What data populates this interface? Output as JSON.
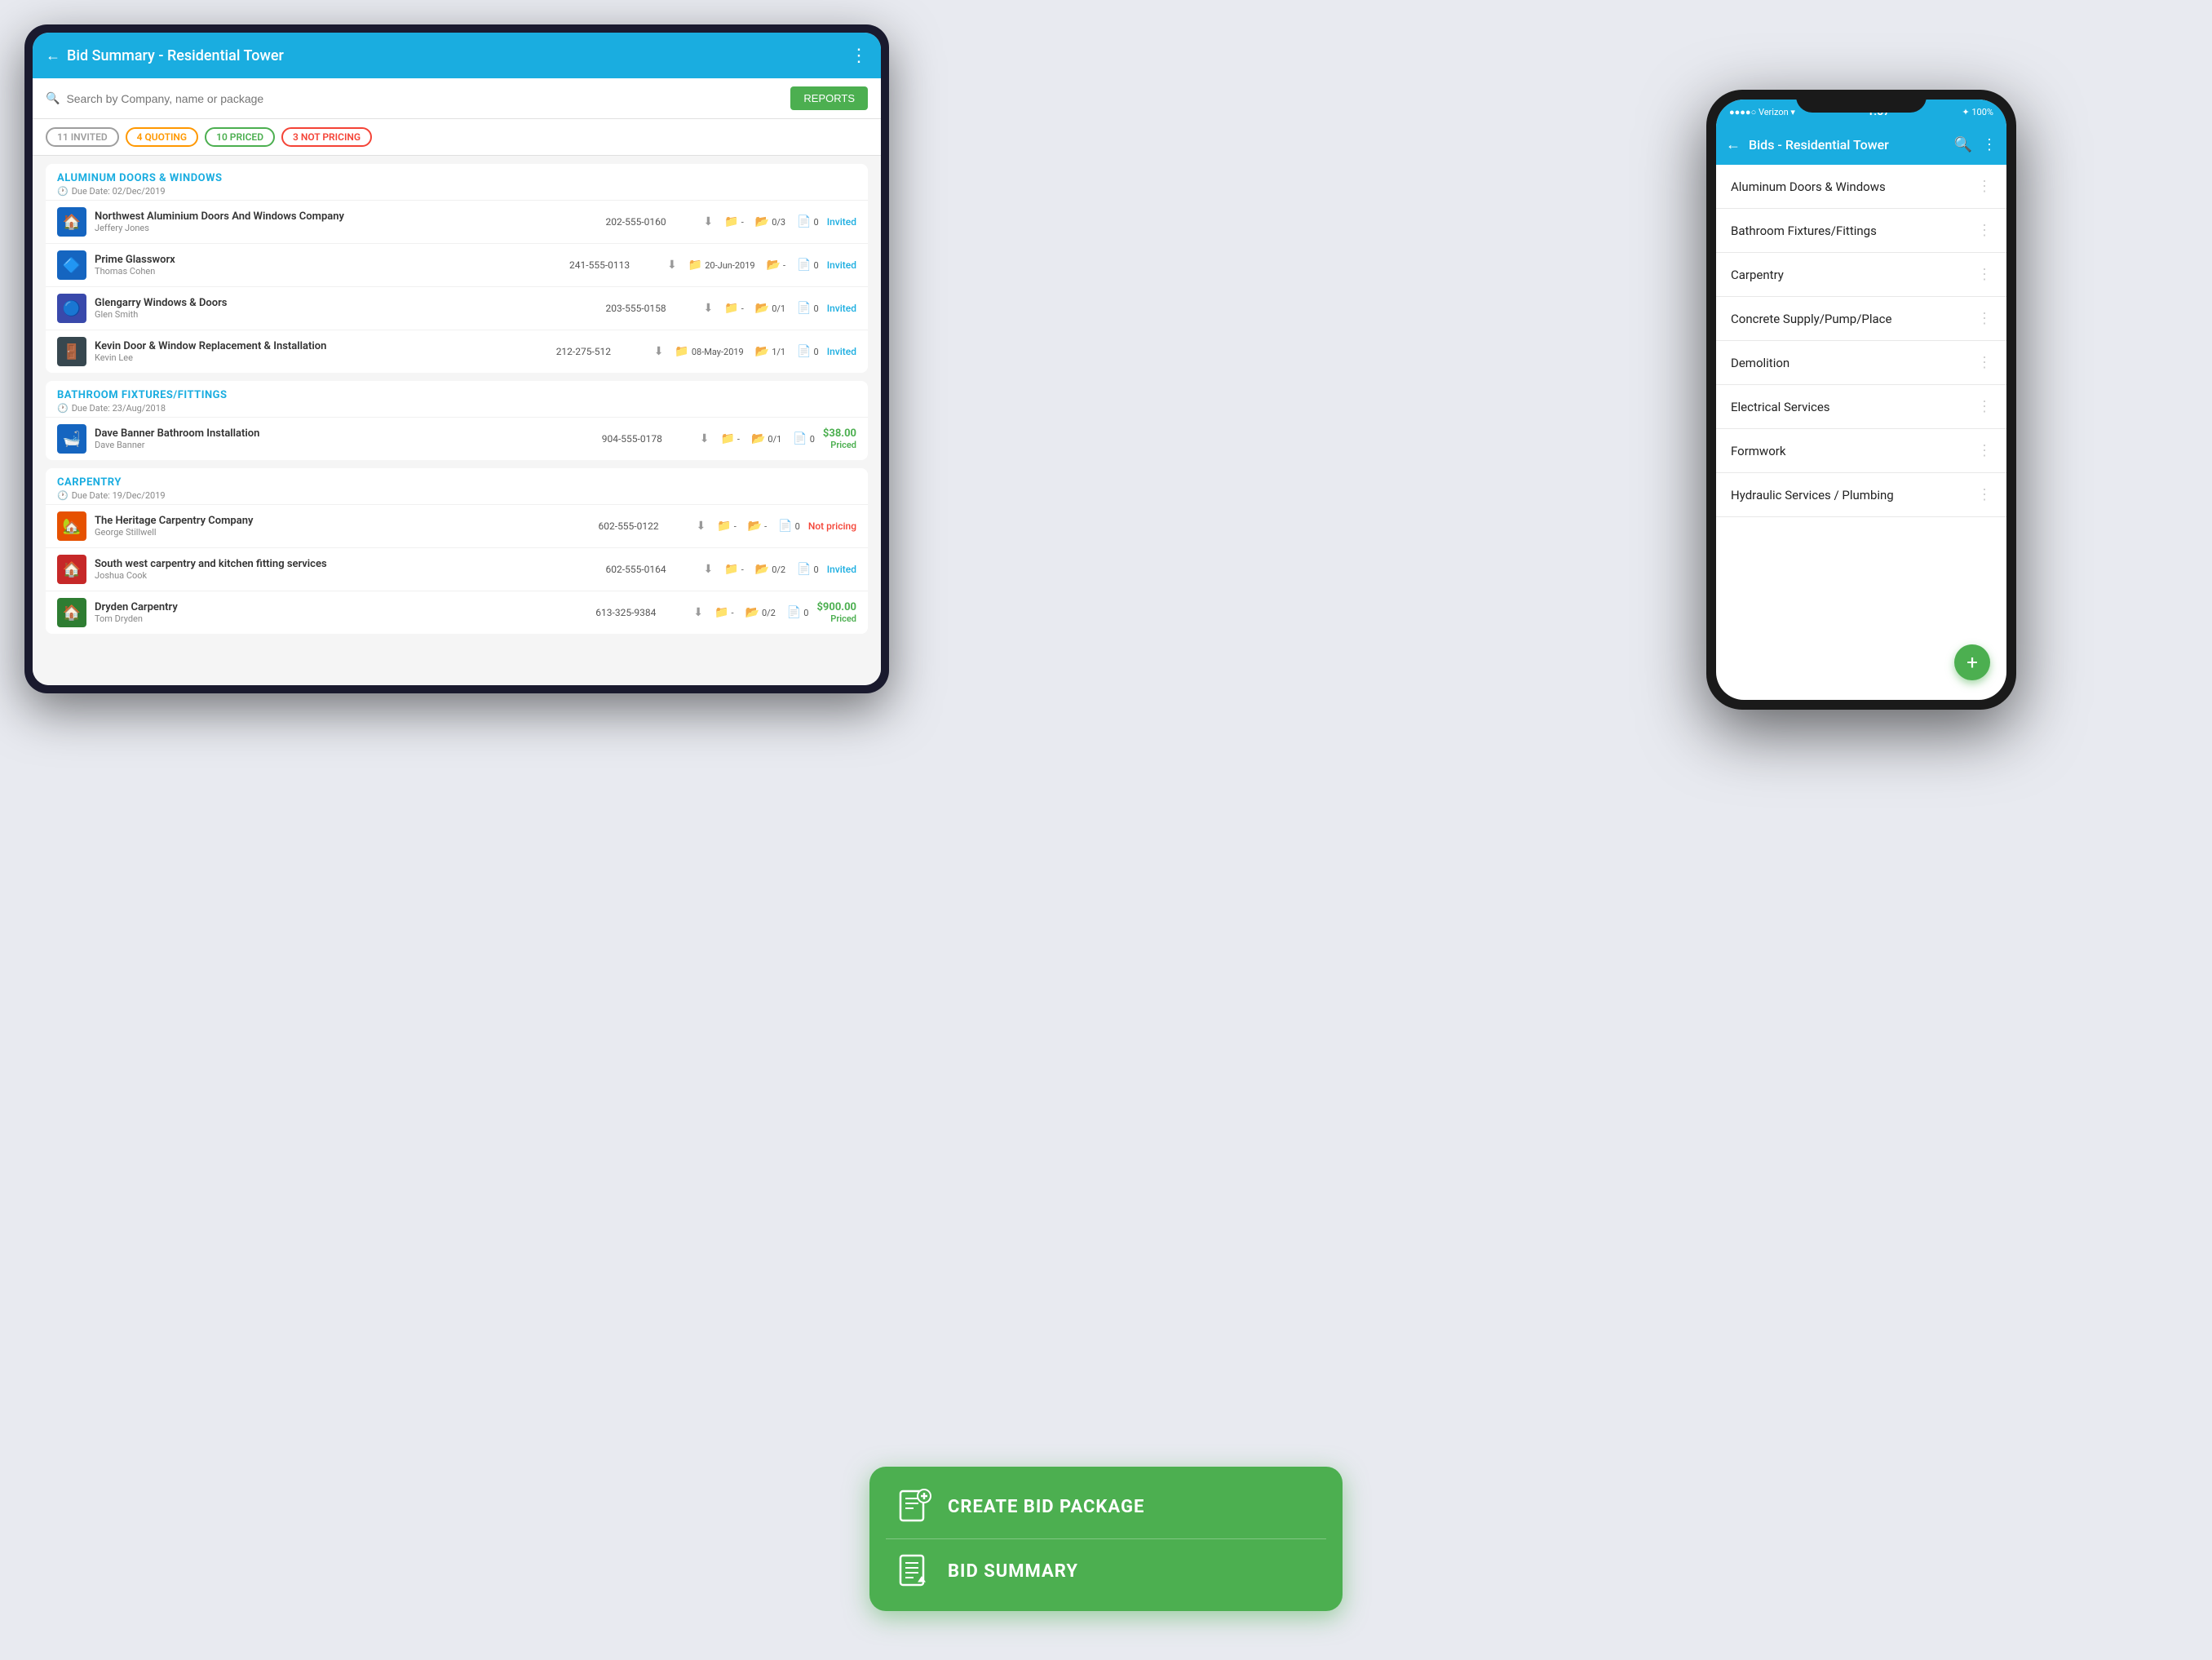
{
  "tablet": {
    "header": {
      "back_label": "←",
      "title": "Bid Summary - Residential Tower",
      "menu_icon": "⋮"
    },
    "search": {
      "placeholder": "Search by Company, name or package"
    },
    "reports_button": "REPORTS",
    "filters": [
      {
        "label": "11 INVITED",
        "style": "gray"
      },
      {
        "label": "4 QUOTING",
        "style": "orange"
      },
      {
        "label": "10 PRICED",
        "style": "green"
      },
      {
        "label": "3 NOT PRICING",
        "style": "red"
      }
    ],
    "categories": [
      {
        "id": "aluminum",
        "title": "ALUMINUM DOORS & WINDOWS",
        "due_date": "Due Date: 02/Dec/2019",
        "companies": [
          {
            "name": "Northwest Aluminium Doors And Windows Company",
            "person": "Jeffery Jones",
            "phone": "202-555-0160",
            "download": "↓",
            "sent": "-",
            "docs_count": "0/3",
            "notes": "0",
            "status": "Invited",
            "status_type": "invited",
            "avatar_color": "av-blue",
            "avatar_icon": "🏠"
          },
          {
            "name": "Prime Glassworx",
            "person": "Thomas Cohen",
            "phone": "241-555-0113",
            "download": "↓",
            "sent": "20-Jun-2019",
            "docs_count": "-",
            "notes": "0",
            "status": "Invited",
            "status_type": "invited",
            "avatar_color": "av-teal",
            "avatar_icon": "🔷"
          },
          {
            "name": "Glengarry Windows & Doors",
            "person": "Glen Smith",
            "phone": "203-555-0158",
            "download": "↓",
            "sent": "-",
            "docs_count": "0/1",
            "notes": "0",
            "status": "Invited",
            "status_type": "invited",
            "avatar_color": "av-indigo",
            "avatar_icon": "🔵"
          },
          {
            "name": "Kevin Door & Window Replacement & Installation",
            "person": "Kevin Lee",
            "phone": "212-275-512",
            "download": "↓",
            "sent": "08-May-2019",
            "docs_count": "1/1",
            "notes": "0",
            "status": "Invited",
            "status_type": "invited",
            "avatar_color": "av-dark",
            "avatar_icon": "🚪"
          }
        ]
      },
      {
        "id": "bathroom",
        "title": "BATHROOM FIXTURES/FITTINGS",
        "due_date": "Due Date: 23/Aug/2018",
        "companies": [
          {
            "name": "Dave Banner Bathroom Installation",
            "person": "Dave Banner",
            "phone": "904-555-0178",
            "download": "↓",
            "sent": "-",
            "docs_count": "0/1",
            "notes": "0",
            "status": "$38.00\nPriced",
            "status_type": "priced",
            "avatar_color": "av-red",
            "avatar_icon": "🛁"
          }
        ]
      },
      {
        "id": "carpentry",
        "title": "CARPENTRY",
        "due_date": "Due Date: 19/Dec/2019",
        "companies": [
          {
            "name": "The Heritage Carpentry Company",
            "person": "George Stillwell",
            "phone": "602-555-0122",
            "download": "↓",
            "sent": "-",
            "docs_count": "-",
            "notes": "0",
            "status": "Not pricing",
            "status_type": "not-pricing",
            "avatar_color": "av-orange",
            "avatar_icon": "🏡"
          },
          {
            "name": "South west carpentry and kitchen fitting services",
            "person": "Joshua Cook",
            "phone": "602-555-0164",
            "download": "↓",
            "sent": "-",
            "docs_count": "0/2",
            "notes": "0",
            "status": "Invited",
            "status_type": "invited",
            "avatar_color": "av-red",
            "avatar_icon": "🏠"
          },
          {
            "name": "Dryden Carpentry",
            "person": "Tom Dryden",
            "phone": "613-325-9384",
            "download": "↓",
            "sent": "-",
            "docs_count": "0/2",
            "notes": "0",
            "status": "$900.00\nPriced",
            "status_type": "priced",
            "avatar_color": "av-green",
            "avatar_icon": "🏠"
          }
        ]
      }
    ]
  },
  "phone": {
    "status_bar": {
      "carrier": "●●●●○ Verizon ▾",
      "time": "1:57",
      "battery": "✦ 100%"
    },
    "header": {
      "back_label": "←",
      "title": "Bids - Residential Tower",
      "search_icon": "🔍",
      "menu_icon": "⋮"
    },
    "list_items": [
      {
        "label": "Aluminum Doors & Windows"
      },
      {
        "label": "Bathroom Fixtures/Fittings"
      },
      {
        "label": "Carpentry"
      },
      {
        "label": "Concrete Supply/Pump/Place"
      },
      {
        "label": "Demolition"
      },
      {
        "label": "Electrical Services"
      },
      {
        "label": "Formwork"
      },
      {
        "label": "Hydraulic Services / Plumbing"
      }
    ],
    "fab_icon": "+"
  },
  "bottom_banner": {
    "items": [
      {
        "label": "CREATE BID PACKAGE",
        "icon_type": "bid-create"
      },
      {
        "label": "BID SUMMARY",
        "icon_type": "bid-summary"
      }
    ]
  }
}
